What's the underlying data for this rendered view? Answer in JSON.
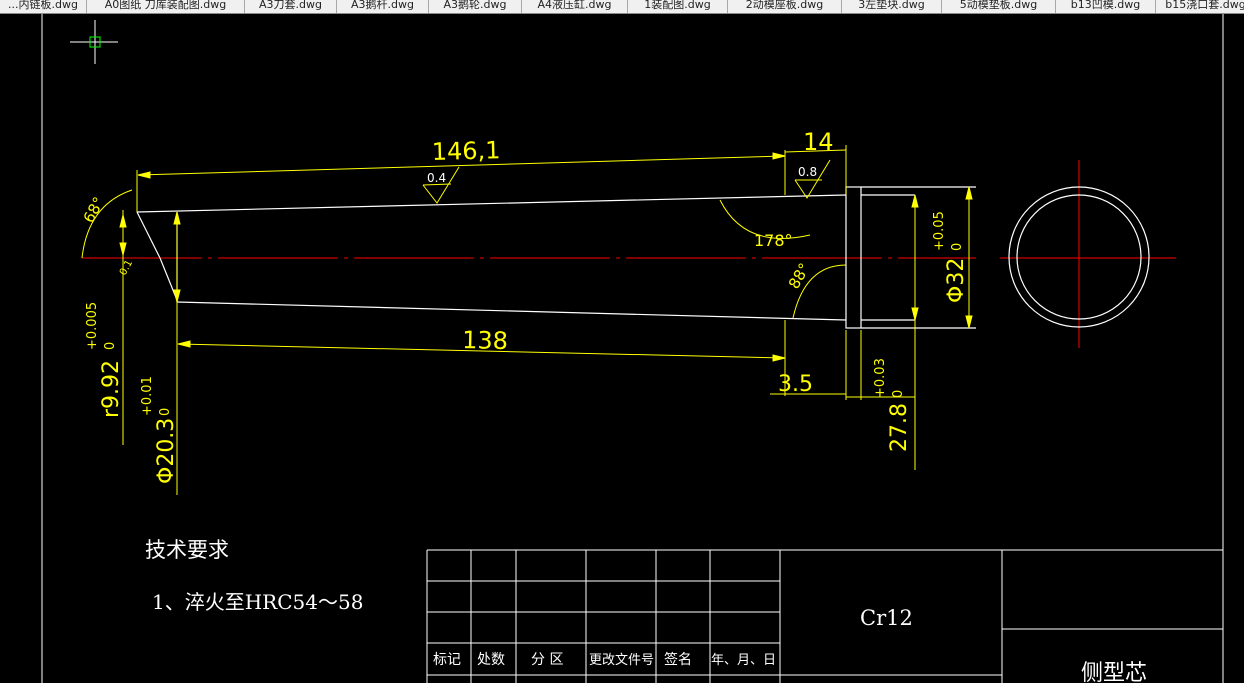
{
  "tabs": [
    {
      "label": "...内链板.dwg"
    },
    {
      "label": "A0图纸 刀库装配图.dwg"
    },
    {
      "label": "A3刀套.dwg"
    },
    {
      "label": "A3鹅杆.dwg"
    },
    {
      "label": "A3鹅轮.dwg"
    },
    {
      "label": "A4液压缸.dwg"
    },
    {
      "label": "1装配图.dwg"
    },
    {
      "label": "2动模座板.dwg"
    },
    {
      "label": "3左垫块.dwg"
    },
    {
      "label": "5动模垫板.dwg"
    },
    {
      "label": "b13凹模.dwg"
    },
    {
      "label": "b15浇口套.dwg"
    }
  ],
  "colors": {
    "background": "#000000",
    "geometry": "#ffffff",
    "dimension": "#ffff00",
    "centerline": "#ff0000",
    "crosshair_box": "#00ff00",
    "tab_bar": "#f0f0f0"
  },
  "drawing": {
    "dims": {
      "len_146": "146,1",
      "len_14": "14",
      "rough_04": "0.4",
      "rough_08": "0.8",
      "angle_178": "178°",
      "angle_68": "68°",
      "angle_88": "88°",
      "len_138": "138",
      "len_35": "3.5",
      "small_note": "0.1",
      "dia_32": "Φ32",
      "dia_32_tol": "+0.05",
      "dia_32_sub": "0",
      "r992": "r9.92",
      "r992_tol": "+0.005",
      "r992_sub": "0",
      "dia_203": "Φ20.3",
      "dia_203_tol": "+0.01",
      "dia_203_sub": "0",
      "len_278": "27.8",
      "len_278_tol": "+0.03",
      "len_278_sub": "0"
    },
    "tech": {
      "title": "技术要求",
      "item1": "1、淬火至HRC54～58"
    },
    "title_block": {
      "headers": [
        "标记",
        "处数",
        "分 区",
        "更改文件号",
        "签名",
        "年、月、日"
      ],
      "material": "Cr12",
      "part_name": "侧型芯"
    }
  }
}
